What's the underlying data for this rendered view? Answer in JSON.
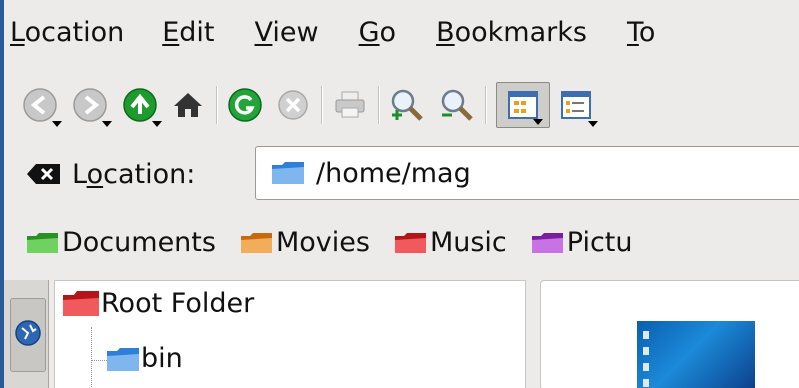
{
  "menubar": {
    "items": [
      {
        "key": "L",
        "rest": "ocation"
      },
      {
        "key": "E",
        "rest": "dit"
      },
      {
        "key": "V",
        "rest": "iew"
      },
      {
        "key": "G",
        "rest": "o"
      },
      {
        "key": "B",
        "rest": "ookmarks"
      },
      {
        "key": "T",
        "rest": "o"
      }
    ]
  },
  "toolbar": {
    "icons": [
      "back-icon",
      "forward-icon",
      "up-icon",
      "home-icon",
      "reload-icon",
      "stop-icon",
      "print-icon",
      "zoom-in-icon",
      "zoom-out-icon",
      "icon-view-icon",
      "detail-view-icon"
    ]
  },
  "location": {
    "label_pre": "L",
    "label_key": "o",
    "label_post": "cation:",
    "value": "/home/mag"
  },
  "bookmarks": [
    {
      "label": "Documents",
      "color": "#3db53a"
    },
    {
      "label": "Movies",
      "color": "#e08a1e"
    },
    {
      "label": "Music",
      "color": "#d8242a"
    },
    {
      "label": "Pictu",
      "color": "#9b36c2"
    }
  ],
  "tree": {
    "root": "Root Folder",
    "child": "bin"
  },
  "colors": {
    "frame": "#2a5a9a",
    "window_bg": "#ecebea"
  }
}
